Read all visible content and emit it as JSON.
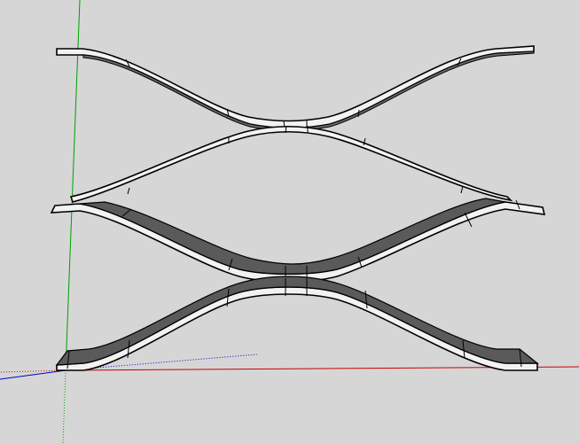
{
  "viewport": {
    "background": "#d6d6d6"
  },
  "axes": {
    "x_color": "#c80000",
    "y_color": "#00a000",
    "z_color": "#0000c8"
  },
  "model": {
    "edge_color": "#000000",
    "top_face_color": "#f2f2f2",
    "side_face_color": "#5a5a5a"
  }
}
